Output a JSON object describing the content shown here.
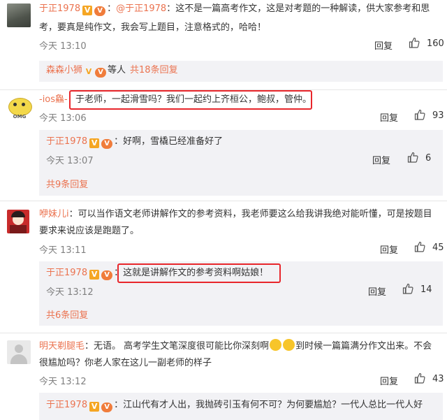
{
  "thread": {
    "top_comment": {
      "user": "于正1978",
      "mention": "@于正1978",
      "text_line1": "：这不是一篇高考作文，这是对考题的一种解读，供大家参考和思",
      "text_line2": "考，要真是纯作文，我会写上题目，注意格式的，哈哈！",
      "time": "今天 13:10",
      "reply_label": "回复",
      "likes": "160"
    },
    "sub_summary": {
      "user": "森森小狮",
      "suffix": "等人",
      "count_text": "共18条回复"
    },
    "c1": {
      "user": "-ios鱻-",
      "text": "于老师，一起滑雪吗？我们一起约上齐桓公，鲍叔，管仲。",
      "time": "今天 13:06",
      "reply_label": "回复",
      "likes": "93",
      "avatar_label": "OMG",
      "reply": {
        "user": "于正1978",
        "text": "：好啊，雪橇已经准备好了",
        "time": "今天 13:07",
        "reply_label": "回复",
        "likes": "6"
      },
      "more": "共9条回复"
    },
    "c2": {
      "user": "咿妹儿i",
      "text_line1": "：可以当作语文老师讲解作文的参考资料，我老师要这么给我讲我绝对能听懂，可是按题目",
      "text_line2": "要求来说应该是跑题了。",
      "time": "今天 13:11",
      "reply_label": "回复",
      "likes": "45",
      "reply": {
        "user": "于正1978",
        "text": "这就是讲解作文的参考资料啊姑娘！",
        "time": "今天 13:12",
        "reply_label": "回复",
        "likes": "14"
      },
      "more": "共6条回复"
    },
    "c3": {
      "user": "明天剃腿毛",
      "text_line1a": "：无语。 高考学生文笔深度很可能比你深刻啊",
      "text_line1b": "到时候一篇篇满分作文出来。不会",
      "text_line2": "很尴尬吗？你老人家在这儿一副老师的样子",
      "time": "今天 13:12",
      "reply_label": "回复",
      "likes": "43",
      "reply": {
        "user": "于正1978",
        "text": "：江山代有才人出，我抛砖引玉有何不可？为何要尴尬？一代人总比一代人好"
      }
    },
    "badges": {
      "v": "V",
      "vip": "V"
    },
    "colors": {
      "username": "#eb7350",
      "highlight": "#e8262b",
      "subbox": "#f2f2f5"
    }
  }
}
